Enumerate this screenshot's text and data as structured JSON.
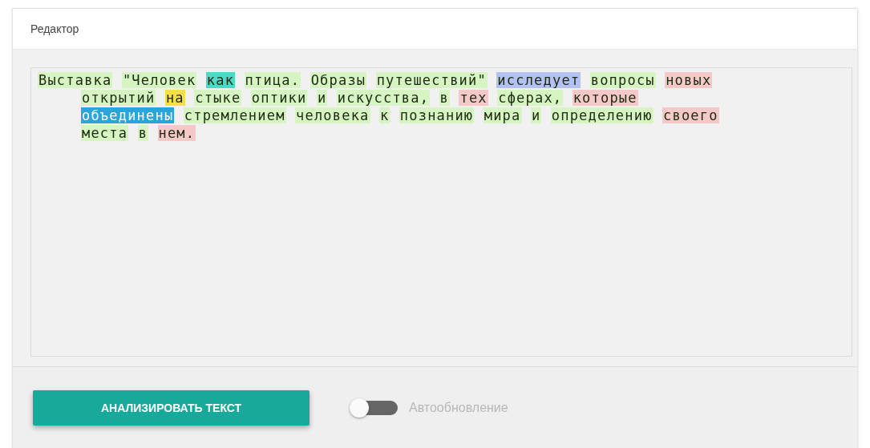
{
  "panel": {
    "title": "Редактор"
  },
  "editor": {
    "lines": [
      {
        "words": [
          {
            "text": "Выставка",
            "color": "#d6f5c3"
          },
          {
            "text": "\"Человек",
            "color": "#d6f5c3"
          },
          {
            "text": "как",
            "color": "#4fd8c6"
          },
          {
            "text": "птица.",
            "color": "#d6f5c3"
          },
          {
            "text": "Образы",
            "color": "#d6f5c3"
          },
          {
            "text": "путешествий\"",
            "color": "#d6f5c3"
          },
          {
            "text": "исследует",
            "color": "#b4c2f3"
          },
          {
            "text": "вопросы",
            "color": "#d6f5c3"
          },
          {
            "text": "новых",
            "color": "#f6c9c9"
          }
        ]
      },
      {
        "words": [
          {
            "text": "открытий",
            "color": "#d6f5c3"
          },
          {
            "text": "на",
            "color": "#f5e04a"
          },
          {
            "text": "стыке",
            "color": "#d6f5c3"
          },
          {
            "text": "оптики",
            "color": "#d6f5c3"
          },
          {
            "text": "и",
            "color": "#d6f5c3"
          },
          {
            "text": "искусства,",
            "color": "#d6f5c3"
          },
          {
            "text": "в",
            "color": "#d6f5c3"
          },
          {
            "text": "тех",
            "color": "#f6c9c9"
          },
          {
            "text": "сферах,",
            "color": "#d6f5c3"
          },
          {
            "text": "которые",
            "color": "#f6c9c9"
          }
        ]
      },
      {
        "words": [
          {
            "text": "объединены",
            "color": "#2aa5dc"
          },
          {
            "text": "стремлением",
            "color": "#d6f5c3"
          },
          {
            "text": "человека",
            "color": "#d6f5c3"
          },
          {
            "text": "к",
            "color": "#d6f5c3"
          },
          {
            "text": "познанию",
            "color": "#d6f5c3"
          },
          {
            "text": "мира",
            "color": "#d6f5c3"
          },
          {
            "text": "и",
            "color": "#d6f5c3"
          },
          {
            "text": "определению",
            "color": "#d6f5c3"
          },
          {
            "text": "своего",
            "color": "#f6c9c9"
          }
        ]
      },
      {
        "words": [
          {
            "text": "места",
            "color": "#d6f5c3"
          },
          {
            "text": "в",
            "color": "#d6f5c3"
          },
          {
            "text": "нем.",
            "color": "#f6c9c9"
          }
        ]
      }
    ]
  },
  "analyze_button": "АНАЛИЗИРОВАТЬ ТЕКСТ",
  "auto_update": {
    "label": "Автообновление",
    "on": false
  }
}
